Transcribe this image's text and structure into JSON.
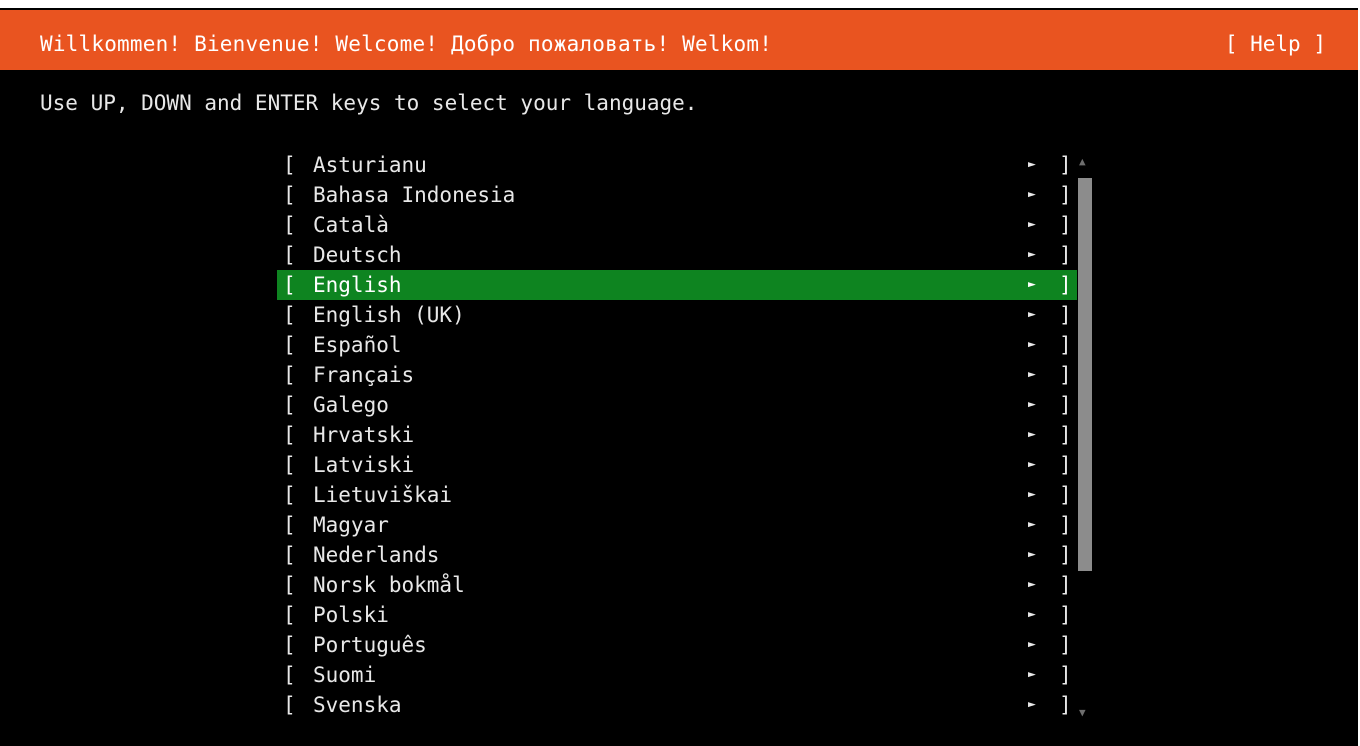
{
  "header": {
    "title": "Willkommen! Bienvenue! Welcome! Добро пожаловать! Welkom!",
    "help_label": "[ Help ]"
  },
  "instruction": "Use UP, DOWN and ENTER keys to select your language.",
  "list": {
    "left_bracket": "[",
    "right_bracket": "]",
    "arrow": "►",
    "selected": "English",
    "items": [
      {
        "label": "Asturianu"
      },
      {
        "label": "Bahasa Indonesia"
      },
      {
        "label": "Català"
      },
      {
        "label": "Deutsch"
      },
      {
        "label": "English"
      },
      {
        "label": "English (UK)"
      },
      {
        "label": "Español"
      },
      {
        "label": "Français"
      },
      {
        "label": "Galego"
      },
      {
        "label": "Hrvatski"
      },
      {
        "label": "Latviski"
      },
      {
        "label": "Lietuviškai"
      },
      {
        "label": "Magyar"
      },
      {
        "label": "Nederlands"
      },
      {
        "label": "Norsk bokmål"
      },
      {
        "label": "Polski"
      },
      {
        "label": "Português"
      },
      {
        "label": "Suomi"
      },
      {
        "label": "Svenska"
      }
    ]
  },
  "scrollbar": {
    "up_icon": "▲",
    "down_icon": "▼"
  },
  "colors": {
    "header_bg": "#e95420",
    "selected_bg": "#0e8420",
    "screen_bg": "#000000"
  }
}
